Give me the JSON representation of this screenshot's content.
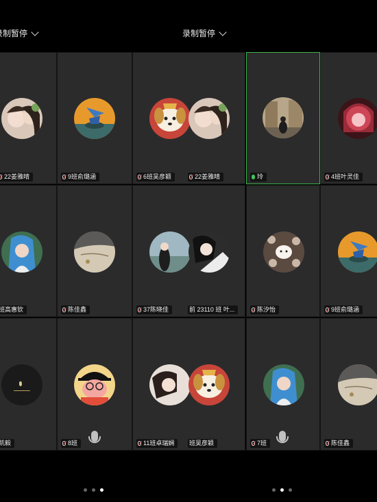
{
  "left_pane": {
    "recording_label": "录制暂停",
    "page_dots": 3,
    "active_dot": 2
  },
  "right_pane": {
    "recording_label": "录制暂停",
    "page_dots": 3,
    "active_dot": 1
  },
  "tiles": {
    "r1": [
      {
        "label": "22姜雅晴",
        "mic": "muted"
      },
      {
        "label": "9班俞璐涵",
        "mic": "muted"
      },
      {
        "label": "6班吴彦颖",
        "mic": "muted"
      },
      {
        "label": "22姜雅晴",
        "mic": "muted"
      },
      {
        "label": "玲",
        "mic": "speaking"
      },
      {
        "label": "4班叶灵佳",
        "mic": "muted"
      }
    ],
    "r2": [
      {
        "label": "班高惠钦",
        "mic": "none"
      },
      {
        "label": "陈佳鑫",
        "mic": "muted"
      },
      {
        "label": "37陈晓佳",
        "mic": "muted"
      },
      {
        "label": "前 23110 班 叶...",
        "mic": "none"
      },
      {
        "label": "陈汐怡",
        "mic": "muted"
      },
      {
        "label": "9班俞璐涵",
        "mic": "muted"
      }
    ],
    "r3": [
      {
        "label": "凯毅",
        "mic": "none"
      },
      {
        "label": "8班",
        "mic": "muted"
      },
      {
        "label": "11班卓瑞娴",
        "mic": "muted"
      },
      {
        "label": "班吴彦颖",
        "mic": "none"
      },
      {
        "label": "7班",
        "mic": "muted"
      },
      {
        "label": "陈佳鑫",
        "mic": "muted"
      }
    ]
  }
}
